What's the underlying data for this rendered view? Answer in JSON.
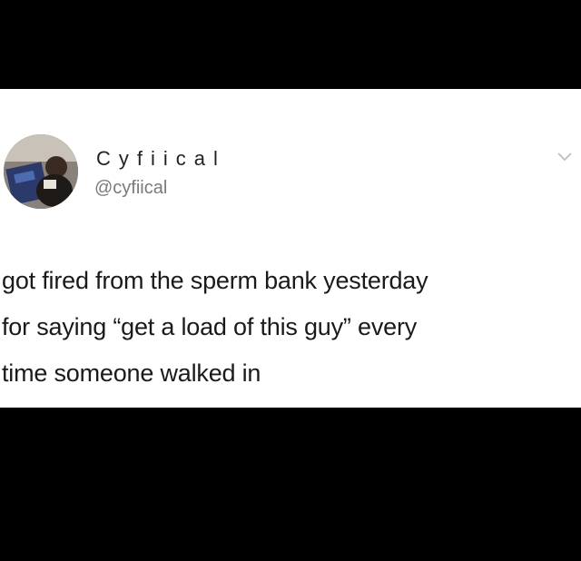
{
  "tweet": {
    "author": {
      "display_name": "Cyfiical",
      "handle": "@cyfiical",
      "avatar_icon": "profile-photo-avatar"
    },
    "menu_icon": "chevron-down-icon",
    "text_lines": [
      "got fired from the sperm bank yesterday",
      "for saying “get a load of this guy” every",
      "time someone walked in"
    ]
  },
  "colors": {
    "background": "#000000",
    "card": "#ffffff",
    "text": "#1a1a1a",
    "handle": "#7a7a7a"
  }
}
